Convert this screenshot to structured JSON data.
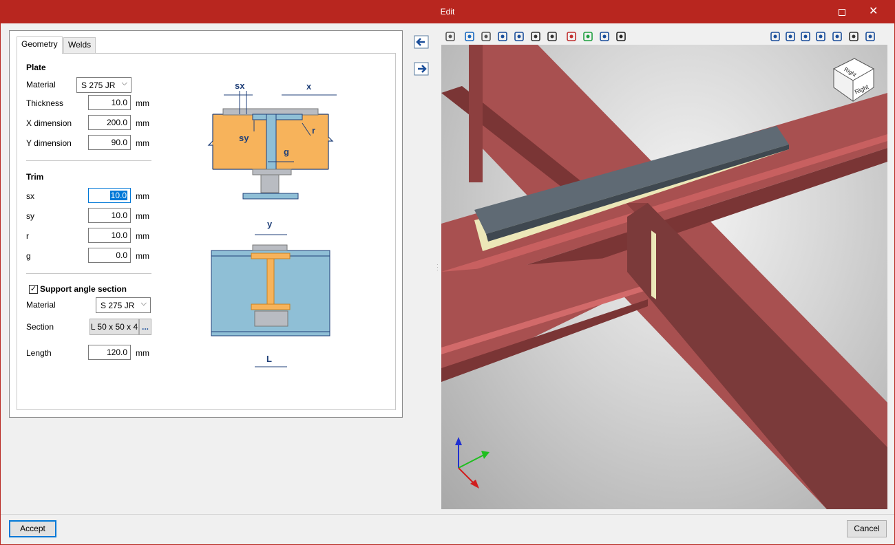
{
  "window": {
    "title": "Edit"
  },
  "tabs": [
    {
      "label": "Geometry",
      "active": true
    },
    {
      "label": "Welds",
      "active": false
    }
  ],
  "plate": {
    "title": "Plate",
    "material_label": "Material",
    "material_value": "S 275 JR",
    "thickness_label": "Thickness",
    "thickness_value": "10.0",
    "xdim_label": "X dimension",
    "xdim_value": "200.0",
    "ydim_label": "Y dimension",
    "ydim_value": "90.0",
    "unit": "mm"
  },
  "trim": {
    "title": "Trim",
    "sx_label": "sx",
    "sx_value": "10.0",
    "sy_label": "sy",
    "sy_value": "10.0",
    "r_label": "r",
    "r_value": "10.0",
    "g_label": "g",
    "g_value": "0.0",
    "unit": "mm"
  },
  "support": {
    "title": "Support angle section",
    "checked": true,
    "material_label": "Material",
    "material_value": "S 275 JR",
    "section_label": "Section",
    "section_value": "L 50 x 50 x 4",
    "section_more": "...",
    "length_label": "Length",
    "length_value": "120.0",
    "unit": "mm"
  },
  "diagram": {
    "labels": {
      "sx": "sx",
      "x": "x",
      "sy": "sy",
      "r": "r",
      "g": "g",
      "y": "y",
      "L": "L"
    },
    "colors": {
      "beam": "#f7b35b",
      "column": "#8fbfd6",
      "plate": "#b9bcc2",
      "dim": "#1f3f78"
    }
  },
  "viewer": {
    "tools": [
      "layers-icon",
      "info-icon",
      "axes-icon",
      "box-view-icon",
      "cube-view-icon",
      "eye-rotate-icon",
      "orbit-icon",
      "section-red-icon",
      "section-green-icon",
      "grid-icon",
      "visibility-icon",
      "zoom-window-icon",
      "zoom-in-icon",
      "zoom-out-icon",
      "rotate-icon",
      "zoom-extents-icon",
      "pan-icon",
      "fit-icon"
    ],
    "navcube_label_top": "Right",
    "navcube_label_side": "Right",
    "colors": {
      "steel": "#a85050",
      "plate": "#5f6a74",
      "weld": "#ece7b8",
      "bg": "#c8c8c8"
    }
  },
  "footer": {
    "accept_label": "Accept",
    "cancel_label": "Cancel"
  }
}
